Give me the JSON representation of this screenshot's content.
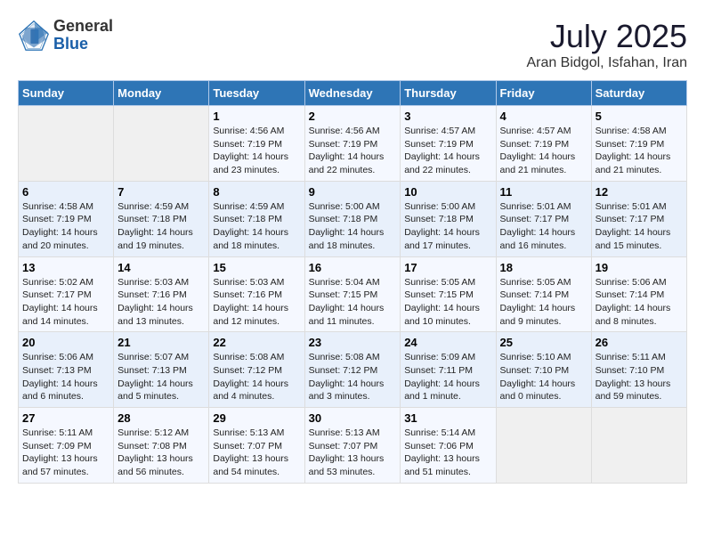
{
  "header": {
    "logo": {
      "general": "General",
      "blue": "Blue"
    },
    "title": "July 2025",
    "location": "Aran Bidgol, Isfahan, Iran"
  },
  "days_of_week": [
    "Sunday",
    "Monday",
    "Tuesday",
    "Wednesday",
    "Thursday",
    "Friday",
    "Saturday"
  ],
  "weeks": [
    [
      {
        "day": null
      },
      {
        "day": null
      },
      {
        "day": "1",
        "sunrise": "Sunrise: 4:56 AM",
        "sunset": "Sunset: 7:19 PM",
        "daylight": "Daylight: 14 hours and 23 minutes."
      },
      {
        "day": "2",
        "sunrise": "Sunrise: 4:56 AM",
        "sunset": "Sunset: 7:19 PM",
        "daylight": "Daylight: 14 hours and 22 minutes."
      },
      {
        "day": "3",
        "sunrise": "Sunrise: 4:57 AM",
        "sunset": "Sunset: 7:19 PM",
        "daylight": "Daylight: 14 hours and 22 minutes."
      },
      {
        "day": "4",
        "sunrise": "Sunrise: 4:57 AM",
        "sunset": "Sunset: 7:19 PM",
        "daylight": "Daylight: 14 hours and 21 minutes."
      },
      {
        "day": "5",
        "sunrise": "Sunrise: 4:58 AM",
        "sunset": "Sunset: 7:19 PM",
        "daylight": "Daylight: 14 hours and 21 minutes."
      }
    ],
    [
      {
        "day": "6",
        "sunrise": "Sunrise: 4:58 AM",
        "sunset": "Sunset: 7:19 PM",
        "daylight": "Daylight: 14 hours and 20 minutes."
      },
      {
        "day": "7",
        "sunrise": "Sunrise: 4:59 AM",
        "sunset": "Sunset: 7:18 PM",
        "daylight": "Daylight: 14 hours and 19 minutes."
      },
      {
        "day": "8",
        "sunrise": "Sunrise: 4:59 AM",
        "sunset": "Sunset: 7:18 PM",
        "daylight": "Daylight: 14 hours and 18 minutes."
      },
      {
        "day": "9",
        "sunrise": "Sunrise: 5:00 AM",
        "sunset": "Sunset: 7:18 PM",
        "daylight": "Daylight: 14 hours and 18 minutes."
      },
      {
        "day": "10",
        "sunrise": "Sunrise: 5:00 AM",
        "sunset": "Sunset: 7:18 PM",
        "daylight": "Daylight: 14 hours and 17 minutes."
      },
      {
        "day": "11",
        "sunrise": "Sunrise: 5:01 AM",
        "sunset": "Sunset: 7:17 PM",
        "daylight": "Daylight: 14 hours and 16 minutes."
      },
      {
        "day": "12",
        "sunrise": "Sunrise: 5:01 AM",
        "sunset": "Sunset: 7:17 PM",
        "daylight": "Daylight: 14 hours and 15 minutes."
      }
    ],
    [
      {
        "day": "13",
        "sunrise": "Sunrise: 5:02 AM",
        "sunset": "Sunset: 7:17 PM",
        "daylight": "Daylight: 14 hours and 14 minutes."
      },
      {
        "day": "14",
        "sunrise": "Sunrise: 5:03 AM",
        "sunset": "Sunset: 7:16 PM",
        "daylight": "Daylight: 14 hours and 13 minutes."
      },
      {
        "day": "15",
        "sunrise": "Sunrise: 5:03 AM",
        "sunset": "Sunset: 7:16 PM",
        "daylight": "Daylight: 14 hours and 12 minutes."
      },
      {
        "day": "16",
        "sunrise": "Sunrise: 5:04 AM",
        "sunset": "Sunset: 7:15 PM",
        "daylight": "Daylight: 14 hours and 11 minutes."
      },
      {
        "day": "17",
        "sunrise": "Sunrise: 5:05 AM",
        "sunset": "Sunset: 7:15 PM",
        "daylight": "Daylight: 14 hours and 10 minutes."
      },
      {
        "day": "18",
        "sunrise": "Sunrise: 5:05 AM",
        "sunset": "Sunset: 7:14 PM",
        "daylight": "Daylight: 14 hours and 9 minutes."
      },
      {
        "day": "19",
        "sunrise": "Sunrise: 5:06 AM",
        "sunset": "Sunset: 7:14 PM",
        "daylight": "Daylight: 14 hours and 8 minutes."
      }
    ],
    [
      {
        "day": "20",
        "sunrise": "Sunrise: 5:06 AM",
        "sunset": "Sunset: 7:13 PM",
        "daylight": "Daylight: 14 hours and 6 minutes."
      },
      {
        "day": "21",
        "sunrise": "Sunrise: 5:07 AM",
        "sunset": "Sunset: 7:13 PM",
        "daylight": "Daylight: 14 hours and 5 minutes."
      },
      {
        "day": "22",
        "sunrise": "Sunrise: 5:08 AM",
        "sunset": "Sunset: 7:12 PM",
        "daylight": "Daylight: 14 hours and 4 minutes."
      },
      {
        "day": "23",
        "sunrise": "Sunrise: 5:08 AM",
        "sunset": "Sunset: 7:12 PM",
        "daylight": "Daylight: 14 hours and 3 minutes."
      },
      {
        "day": "24",
        "sunrise": "Sunrise: 5:09 AM",
        "sunset": "Sunset: 7:11 PM",
        "daylight": "Daylight: 14 hours and 1 minute."
      },
      {
        "day": "25",
        "sunrise": "Sunrise: 5:10 AM",
        "sunset": "Sunset: 7:10 PM",
        "daylight": "Daylight: 14 hours and 0 minutes."
      },
      {
        "day": "26",
        "sunrise": "Sunrise: 5:11 AM",
        "sunset": "Sunset: 7:10 PM",
        "daylight": "Daylight: 13 hours and 59 minutes."
      }
    ],
    [
      {
        "day": "27",
        "sunrise": "Sunrise: 5:11 AM",
        "sunset": "Sunset: 7:09 PM",
        "daylight": "Daylight: 13 hours and 57 minutes."
      },
      {
        "day": "28",
        "sunrise": "Sunrise: 5:12 AM",
        "sunset": "Sunset: 7:08 PM",
        "daylight": "Daylight: 13 hours and 56 minutes."
      },
      {
        "day": "29",
        "sunrise": "Sunrise: 5:13 AM",
        "sunset": "Sunset: 7:07 PM",
        "daylight": "Daylight: 13 hours and 54 minutes."
      },
      {
        "day": "30",
        "sunrise": "Sunrise: 5:13 AM",
        "sunset": "Sunset: 7:07 PM",
        "daylight": "Daylight: 13 hours and 53 minutes."
      },
      {
        "day": "31",
        "sunrise": "Sunrise: 5:14 AM",
        "sunset": "Sunset: 7:06 PM",
        "daylight": "Daylight: 13 hours and 51 minutes."
      },
      {
        "day": null
      },
      {
        "day": null
      }
    ]
  ]
}
